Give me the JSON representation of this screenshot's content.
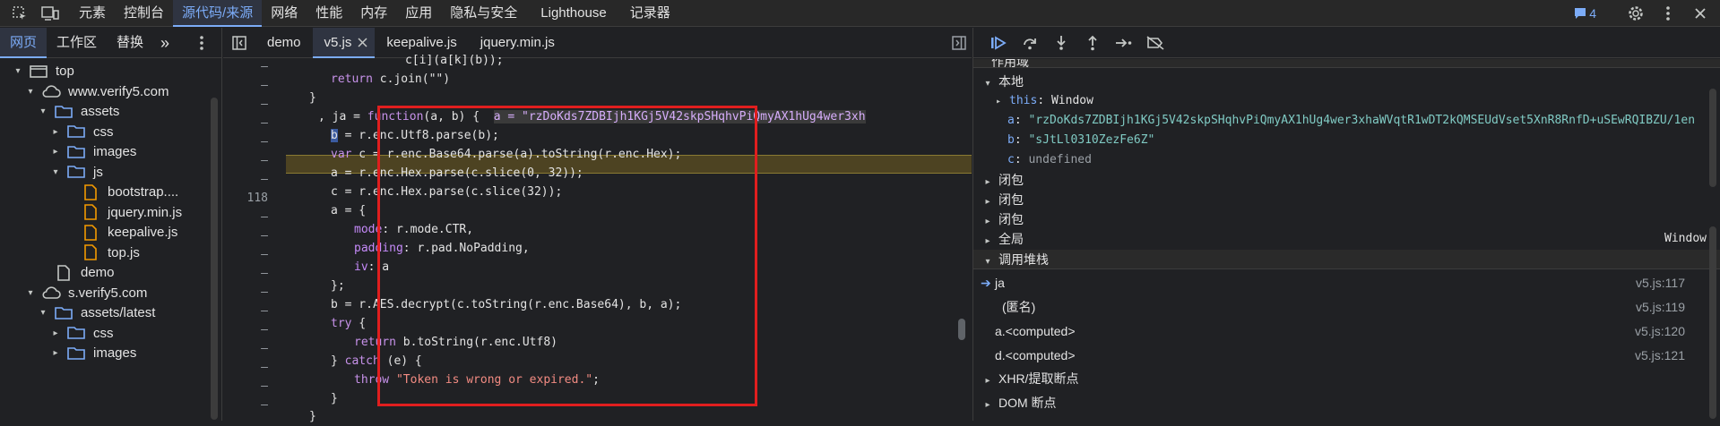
{
  "top_tabs": [
    "元素",
    "控制台",
    "源代码/来源",
    "网络",
    "性能",
    "内存",
    "应用",
    "隐私与安全",
    "Lighthouse",
    "记录器"
  ],
  "active_top_tab": "源代码/来源",
  "issues_count": "4",
  "nav_tabs": [
    "网页",
    "工作区",
    "替换"
  ],
  "nav_more": "»",
  "tree": [
    {
      "label": "top",
      "type": "frame",
      "arrow": "▾"
    },
    {
      "label": "www.verify5.com",
      "type": "cloud",
      "arrow": "▾"
    },
    {
      "label": "assets",
      "type": "folder",
      "arrow": "▾"
    },
    {
      "label": "css",
      "type": "folder",
      "arrow": "▸"
    },
    {
      "label": "images",
      "type": "folder",
      "arrow": "▸"
    },
    {
      "label": "js",
      "type": "folder",
      "arrow": "▾"
    },
    {
      "label": "bootstrap....",
      "type": "file-js",
      "arrow": ""
    },
    {
      "label": "jquery.min.js",
      "type": "file-js",
      "arrow": ""
    },
    {
      "label": "keepalive.js",
      "type": "file-js",
      "arrow": ""
    },
    {
      "label": "top.js",
      "type": "file-js",
      "arrow": ""
    },
    {
      "label": "demo",
      "type": "file",
      "arrow": ""
    },
    {
      "label": "s.verify5.com",
      "type": "cloud",
      "arrow": "▾"
    },
    {
      "label": "assets/latest",
      "type": "folder",
      "arrow": "▾"
    },
    {
      "label": "css",
      "type": "folder",
      "arrow": "▸"
    },
    {
      "label": "images",
      "type": "folder",
      "arrow": "▸"
    }
  ],
  "editor_tabs": [
    "demo",
    "v5.js",
    "keepalive.js",
    "jquery.min.js"
  ],
  "active_editor_tab": "v5.js",
  "line_number_118": "118",
  "code": {
    "l0": "c[i](a[k](b));",
    "l1a": "return",
    "l1b": " c.join(\"\")",
    "l2": "}",
    "l3a": ", ja = ",
    "l3b": "function",
    "l3c": "(a, b) {  ",
    "l3d": "a = \"rzDoKds7ZDBIjh1KGj5V42skpSHqhvPiQmyAX1hUg4wer3xh",
    "l4": "b = r.enc.Utf8.parse(b);",
    "l5a": "var",
    "l5b": " c = r.enc.Base64.parse(a).toString(r.enc.Hex);",
    "l6": "a = r.enc.Hex.parse(c.slice(0, 32));",
    "l7": "c = r.enc.Hex.parse(c.slice(32));",
    "l8": "a = {",
    "l9a": "mode",
    "l9b": ": r.mode.CTR,",
    "l10a": "padding",
    "l10b": ": r.pad.NoPadding,",
    "l11a": "iv",
    "l11b": ": a",
    "l12": "};",
    "l13": "b = r.AES.decrypt(c.toString(r.enc.Base64), b, a);",
    "l14a": "try",
    "l14b": " {",
    "l15a": "return",
    "l15b": " b.toString(r.enc.Utf8)",
    "l16a": "} ",
    "l16b": "catch",
    "l16c": " (e) {",
    "l17a": "throw",
    "l17b": " ",
    "l17c": "\"Token is wrong or expired.\"",
    "l17d": ";",
    "l18": "}",
    "l19": "}"
  },
  "scope": {
    "header": "作用域",
    "local": "本地",
    "this_key": "this",
    "this_val": "Window",
    "a_key": "a",
    "a_val": "\"rzDoKds7ZDBIjh1KGj5V42skpSHqhvPiQmyAX1hUg4wer3xhaWVqtR1wDT2kQMSEUdVset5XnR8RnfD+uSEwRQIBZU/1en",
    "b_key": "b",
    "b_val": "\"sJtLl0310ZezFe6Z\"",
    "c_key": "c",
    "c_val": "undefined",
    "closure1": "闭包",
    "closure2": "闭包",
    "closure3": "闭包",
    "global": "全局",
    "global_val": "Window"
  },
  "callstack": {
    "header": "调用堆栈",
    "frames": [
      {
        "name": "ja",
        "loc": "v5.js:117"
      },
      {
        "name": "(匿名)",
        "loc": "v5.js:119"
      },
      {
        "name": "a.<computed>",
        "loc": "v5.js:120"
      },
      {
        "name": "d.<computed>",
        "loc": "v5.js:121"
      }
    ]
  },
  "xhr_breakpoints": "XHR/提取断点",
  "dom_breakpoints": "DOM 断点",
  "colors": {
    "accent": "#7cacf8",
    "highlight": "#4d4322",
    "redbox": "#e01e1e",
    "string": "#f28b82",
    "keyword": "#c792ea"
  }
}
